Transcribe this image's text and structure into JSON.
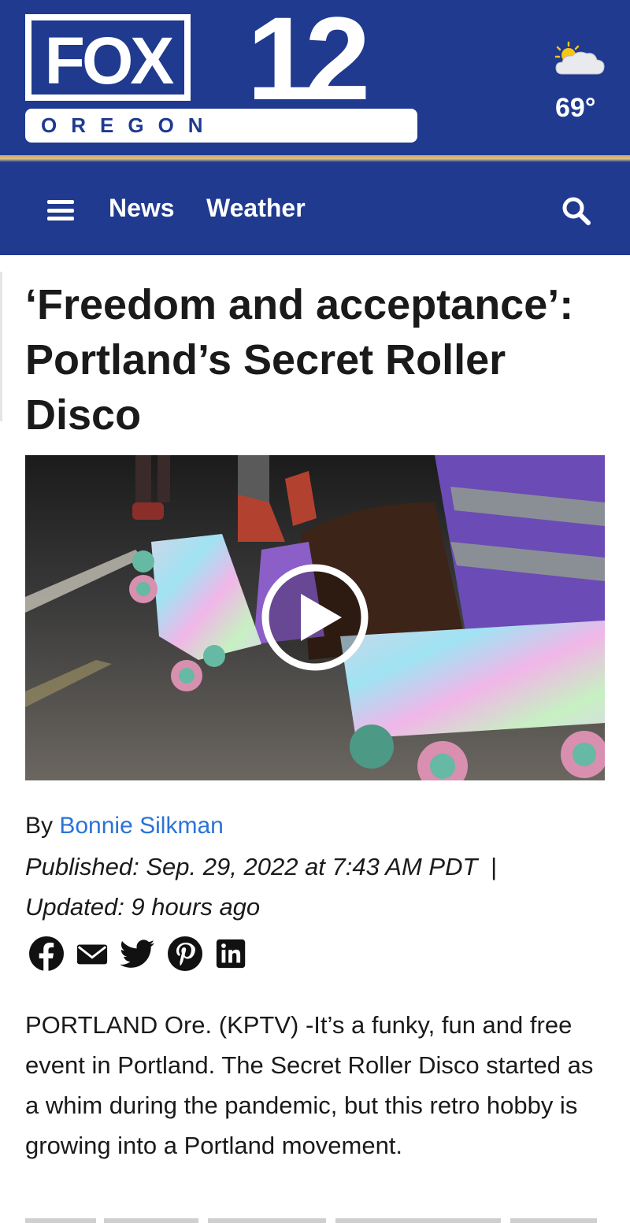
{
  "header": {
    "logo_brand": "FOX",
    "logo_number": "12",
    "logo_region": "OREGON",
    "weather_icon": "partly-cloudy-icon",
    "temperature": "69°"
  },
  "nav": {
    "menu_icon": "hamburger-menu-icon",
    "items": [
      {
        "label": "News"
      },
      {
        "label": "Weather"
      }
    ],
    "search_icon": "search-icon"
  },
  "article": {
    "headline": "‘Freedom and acceptance’: Portland’s Secret Roller Disco",
    "video": {
      "play_icon": "play-icon"
    },
    "byline_prefix": "By",
    "author": "Bonnie Silkman",
    "published": "Published: Sep. 29, 2022 at 7:43 AM PDT",
    "separator": "|",
    "updated": "Updated: 9 hours ago",
    "share_icons": [
      "facebook-icon",
      "email-icon",
      "twitter-icon",
      "pinterest-icon",
      "linkedin-icon"
    ],
    "body": "PORTLAND Ore. (KPTV) -It’s a funky, fun and free event in Portland. The Secret Roller Disco started as a whim during the pandemic, but this retro hobby is growing into a Portland movement."
  },
  "colors": {
    "brand_blue": "#1f3a8f",
    "accent_gold": "#c9a15a",
    "link_blue": "#2a73d8",
    "text": "#1a1a1a"
  }
}
